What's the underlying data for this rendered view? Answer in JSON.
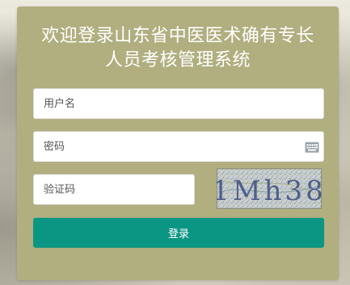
{
  "page": {
    "title": "欢迎登录山东省中医医术确有专长人员考核管理系统"
  },
  "form": {
    "username_placeholder": "用户名",
    "password_placeholder": "密码",
    "captcha_placeholder": "验证码",
    "captcha_text": "1Mh38",
    "login_label": "登录"
  },
  "icons": {
    "keyboard": "keyboard-icon"
  },
  "colors": {
    "panel": "#b1ae7f",
    "button": "#0b9583",
    "text_white": "#ffffff"
  }
}
